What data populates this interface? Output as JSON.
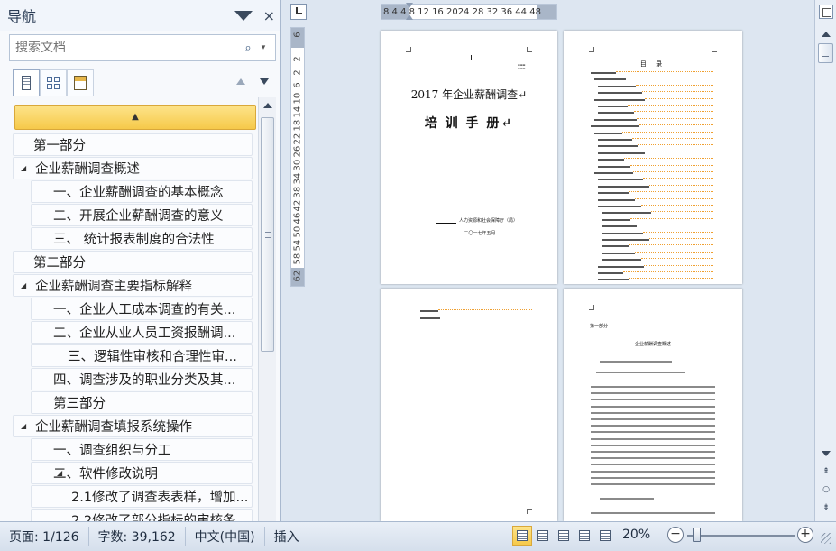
{
  "nav": {
    "title": "导航",
    "close_glyph": "×",
    "search_placeholder": "搜索文档",
    "search_icon_glyph": "⌕",
    "search_dropdown_glyph": "▾",
    "collapse_glyph": "▲"
  },
  "tree": [
    {
      "label": "第一部分",
      "level": 1,
      "toggle": ""
    },
    {
      "label": "企业薪酬调查概述",
      "level": 0,
      "toggle": "◢"
    },
    {
      "label": "一、企业薪酬调查的基本概念",
      "level": 2,
      "toggle": ""
    },
    {
      "label": "二、开展企业薪酬调查的意义",
      "level": 2,
      "toggle": ""
    },
    {
      "label": "三、 统计报表制度的合法性",
      "level": 2,
      "toggle": ""
    },
    {
      "label": "第二部分",
      "level": 1,
      "toggle": ""
    },
    {
      "label": "企业薪酬调查主要指标解释",
      "level": 0,
      "toggle": "◢"
    },
    {
      "label": "一、企业人工成本调查的有关...",
      "level": 2,
      "toggle": ""
    },
    {
      "label": "二、企业从业人员工资报酬调...",
      "level": 2,
      "toggle": ""
    },
    {
      "label": "三、逻辑性审核和合理性审...",
      "level": 3,
      "toggle": ""
    },
    {
      "label": "四、调查涉及的职业分类及其...",
      "level": 2,
      "toggle": ""
    },
    {
      "label": "第三部分",
      "level": 2,
      "toggle": ""
    },
    {
      "label": "企业薪酬调查填报系统操作",
      "level": 0,
      "toggle": "◢"
    },
    {
      "label": "一、调查组织与分工",
      "level": 2,
      "toggle": ""
    },
    {
      "label": "二、软件修改说明",
      "level": 2,
      "toggle": "◢"
    },
    {
      "label": "2.1修改了调查表表样，增加...",
      "level": 4,
      "toggle": ""
    },
    {
      "label": "2.2修改了部分指标的审核条...",
      "level": 4,
      "toggle": ""
    }
  ],
  "rulers": {
    "horizontal": "8  4   4  8  12 16 2024 28 32 36   44 48",
    "vertical_ticks": [
      "6",
      "2",
      "2",
      "6",
      "10",
      "14",
      "18",
      "22",
      "26",
      "30",
      "34",
      "38",
      "42",
      "46",
      "50",
      "54",
      "58",
      "62"
    ]
  },
  "document": {
    "page1": {
      "title": "2017 年企业薪酬调查↵",
      "subtitle": "培 训 手 册↵",
      "org": "人力资源和社会保障厅（局）",
      "date": "二〇一七年五月"
    },
    "page2": {
      "toc_title": "目  录"
    },
    "page4": {
      "part": "第一部分",
      "heading": "企业薪酬调查概述"
    }
  },
  "status": {
    "page": "页面: 1/126",
    "words": "字数: 39,162",
    "language": "中文(中国)",
    "mode": "插入",
    "zoom": "20%",
    "zoom_fraction": 0.05
  },
  "colors": {
    "accent_highlight": "#f6c94a",
    "toc_leader": "#f0a030"
  }
}
